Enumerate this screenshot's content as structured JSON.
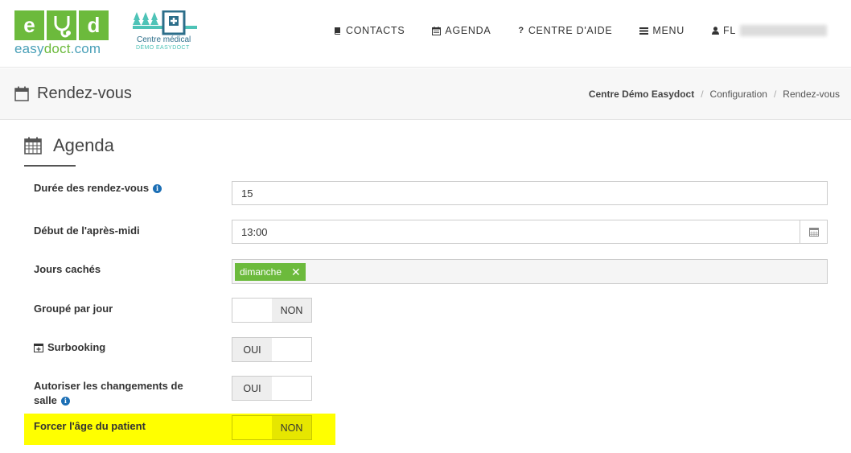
{
  "brand": {
    "letters": [
      "e",
      "d"
    ],
    "text_prefix": "easy",
    "text_bold": "doct",
    "text_suffix": ".com"
  },
  "centre": {
    "name": "Centre médical",
    "subtitle": "DÉMO EASYDOCT"
  },
  "nav": [
    {
      "label": "CONTACTS",
      "icon": "book-icon"
    },
    {
      "label": "AGENDA",
      "icon": "calendar-icon"
    },
    {
      "label": "CENTRE D'AIDE",
      "icon": "question-icon"
    },
    {
      "label": "MENU",
      "icon": "bars-icon"
    },
    {
      "label": "FL",
      "icon": "user-icon"
    }
  ],
  "page": {
    "title": "Rendez-vous",
    "breadcrumb": [
      "Centre Démo Easydoct",
      "Configuration",
      "Rendez-vous"
    ]
  },
  "section": {
    "title": "Agenda"
  },
  "form": {
    "duree": {
      "label": "Durée des rendez-vous",
      "value": "15"
    },
    "debut": {
      "label": "Début de l'après-midi",
      "value": "13:00"
    },
    "jours": {
      "label": "Jours cachés",
      "tag": "dimanche"
    },
    "groupe": {
      "label": "Groupé par jour",
      "state": "NON"
    },
    "surbooking": {
      "label": "Surbooking",
      "state": "OUI"
    },
    "autoriser": {
      "label_line1": "Autoriser les changements de",
      "label_line2": "salle",
      "state": "OUI"
    },
    "forcer": {
      "label": "Forcer l'âge du patient",
      "state": "NON"
    }
  },
  "colors": {
    "brand_green": "#6cba3c",
    "brand_blue": "#4aa0b8",
    "highlight": "#ffff00",
    "info_blue": "#1c6fb5"
  }
}
